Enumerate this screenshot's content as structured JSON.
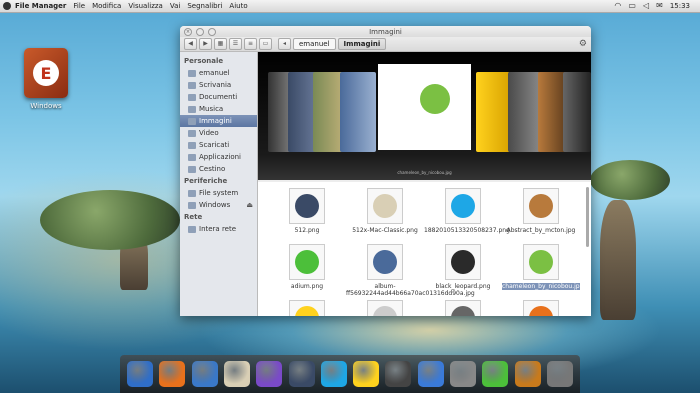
{
  "menubar": {
    "app_name": "File Manager",
    "menus": [
      "File",
      "Modifica",
      "Visualizza",
      "Vai",
      "Segnalibri",
      "Aiuto"
    ],
    "clock": "15:33",
    "tray_icons": [
      "wifi-icon",
      "battery-icon",
      "volume-icon",
      "mail-icon"
    ]
  },
  "desktop": {
    "icon_label": "Windows"
  },
  "window": {
    "title": "Immagini",
    "breadcrumbs": [
      "emanuel",
      "Immagini"
    ],
    "toolbar_icons": [
      "back-icon",
      "forward-icon",
      "icon-view-icon",
      "list-view-icon",
      "compact-view-icon",
      "coverflow-view-icon",
      "gear-icon"
    ]
  },
  "sidebar": {
    "sections": [
      {
        "heading": "Personale",
        "items": [
          "emanuel",
          "Scrivania",
          "Documenti",
          "Musica",
          "Immagini",
          "Video",
          "Scaricati",
          "Applicazioni",
          "Cestino"
        ]
      },
      {
        "heading": "Periferiche",
        "items": [
          "File system",
          "Windows"
        ]
      },
      {
        "heading": "Rete",
        "items": [
          "Intera rete"
        ]
      }
    ],
    "selected": "Immagini"
  },
  "coverflow": {
    "caption": "chameleon_by_nicobou.jpg"
  },
  "files": [
    {
      "name": "512.png",
      "icon": "itunes-icon",
      "color": "#3a4a66"
    },
    {
      "name": "512x-Mac-Classic.png",
      "icon": "mac-classic-icon",
      "color": "#d9cfb5"
    },
    {
      "name": "1882010513320508237.png",
      "icon": "skype-icon",
      "color": "#1ea7e6"
    },
    {
      "name": "Abstract_by_mcton.jpg",
      "icon": "abstract-icon",
      "color": "#b87a3c"
    },
    {
      "name": "adium.png",
      "icon": "adium-icon",
      "color": "#4cbf3a"
    },
    {
      "name": "album-ff56932244ad44b66a70ac01316dd90a.jpg",
      "icon": "album-icon",
      "color": "#4a6a9a"
    },
    {
      "name": "black_leopard.png",
      "icon": "leopard-icon",
      "color": "#2a2a2a"
    },
    {
      "name": "chameleon_by_nicobou.jpg",
      "icon": "chameleon-icon",
      "color": "#7bc043"
    },
    {
      "name": "",
      "icon": "duck-icon",
      "color": "#ffd21e"
    },
    {
      "name": "",
      "icon": "document-icon",
      "color": "#cccccc"
    },
    {
      "name": "",
      "icon": "fan-icon",
      "color": "#666666"
    },
    {
      "name": "",
      "icon": "firefox-icon",
      "color": "#e8711c"
    }
  ],
  "selected_file": "chameleon_by_nicobou.jpg",
  "dock": [
    {
      "name": "finder-icon",
      "color": "#2f6ec8"
    },
    {
      "name": "firefox-icon",
      "color": "#e8711c"
    },
    {
      "name": "thunderbird-icon",
      "color": "#3a78c8"
    },
    {
      "name": "mac-classic-icon",
      "color": "#d9cfb5"
    },
    {
      "name": "book-icon",
      "color": "#7a4ac8"
    },
    {
      "name": "itunes-icon",
      "color": "#3a4a66"
    },
    {
      "name": "skype-icon",
      "color": "#1ea7e6"
    },
    {
      "name": "duck-icon",
      "color": "#ffd21e"
    },
    {
      "name": "photos-icon",
      "color": "#444444"
    },
    {
      "name": "xcode-icon",
      "color": "#3a7ad8"
    },
    {
      "name": "disk-utility-icon",
      "color": "#888888"
    },
    {
      "name": "adium-icon",
      "color": "#4cbf3a"
    },
    {
      "name": "ring-icon",
      "color": "#c87a1c"
    },
    {
      "name": "trash-icon",
      "color": "#777777"
    }
  ]
}
